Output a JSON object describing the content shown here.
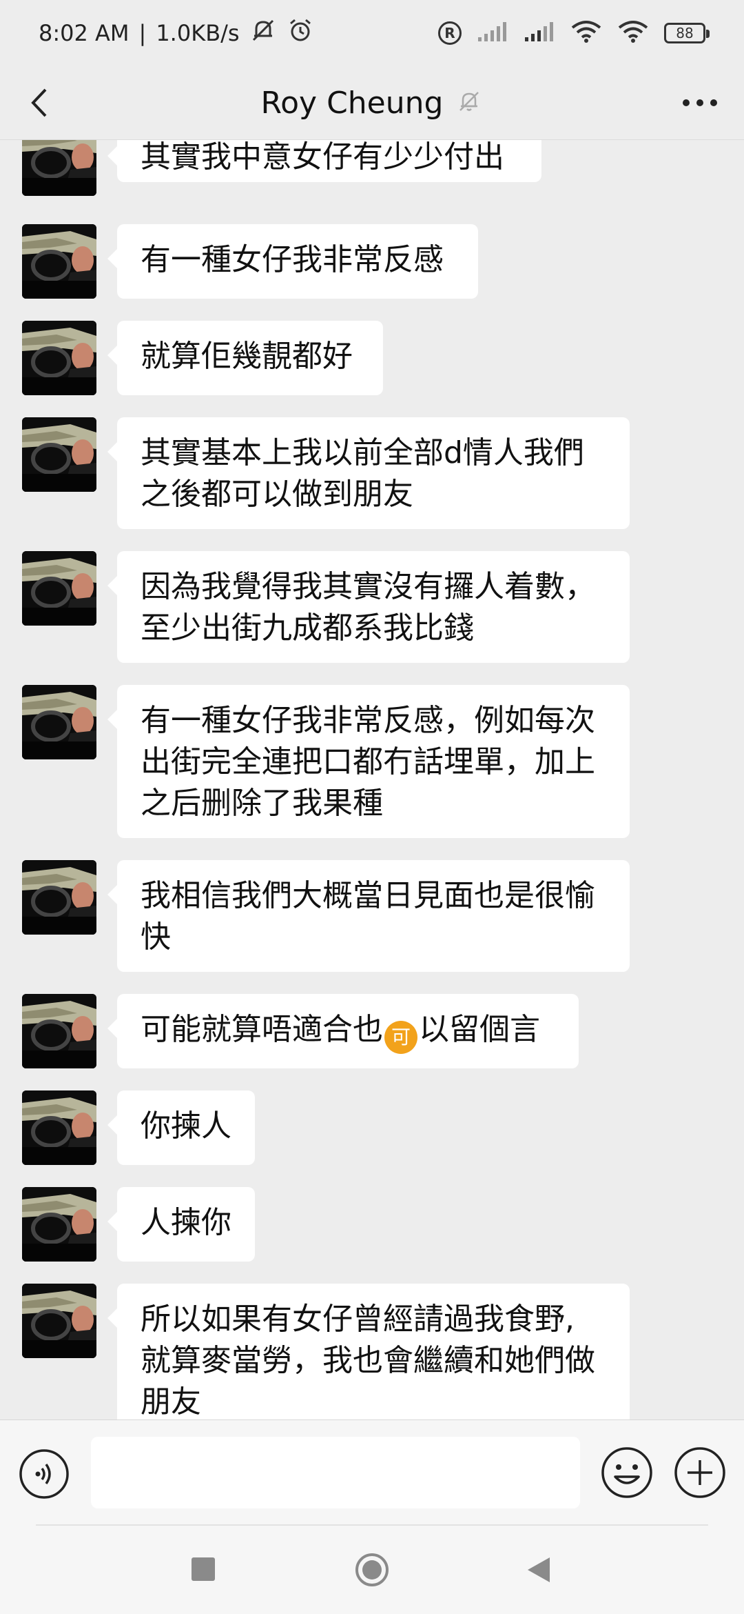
{
  "status_bar": {
    "time": "8:02 AM",
    "separator": "|",
    "network_speed": "1.0KB/s",
    "battery_level": "88",
    "icons": [
      "bell-muted-icon",
      "alarm-icon",
      "registered-icon",
      "signal-icon",
      "signal-icon",
      "wifi-icon",
      "wifi-icon",
      "battery-icon"
    ]
  },
  "header": {
    "title": "Roy Cheung",
    "icons": [
      "back-arrow-icon",
      "mute-bell-icon",
      "more-dots-icon"
    ]
  },
  "messages": [
    {
      "text": "其實我中意女仔有少少付出"
    },
    {
      "text": "有一種女仔我非常反感"
    },
    {
      "text": "就算佢幾靚都好"
    },
    {
      "text": "其實基本上我以前全部d情人我們\n之後都可以做到朋友"
    },
    {
      "text": "因為我覺得我其實沒有攞人着數，\n至少出街九成都系我比錢"
    },
    {
      "text": "有一種女仔我非常反感，例如每次\n出街完全連把口都冇話埋單，加上\n之后删除了我果種"
    },
    {
      "text": "我相信我們大概當日見面也是很愉\n快"
    },
    {
      "text_before": "可能就算唔適合也",
      "emoji": "可",
      "text_after": "以留個言"
    },
    {
      "text": "你揀人"
    },
    {
      "text": "人揀你"
    },
    {
      "text": "所以如果有女仔曾經請過我食野,\n就算麥當勞，我也會繼續和她們做\n朋友"
    }
  ],
  "input_bar": {
    "placeholder": "",
    "value": "",
    "icons": [
      "voice-icon",
      "emoji-icon",
      "plus-icon"
    ]
  },
  "nav_bar": {
    "icons": [
      "recents-square-icon",
      "home-circle-icon",
      "back-triangle-icon"
    ]
  },
  "colors": {
    "background": "#ededed",
    "bubble": "#ffffff",
    "emoji_coin": "#f2a21b"
  }
}
